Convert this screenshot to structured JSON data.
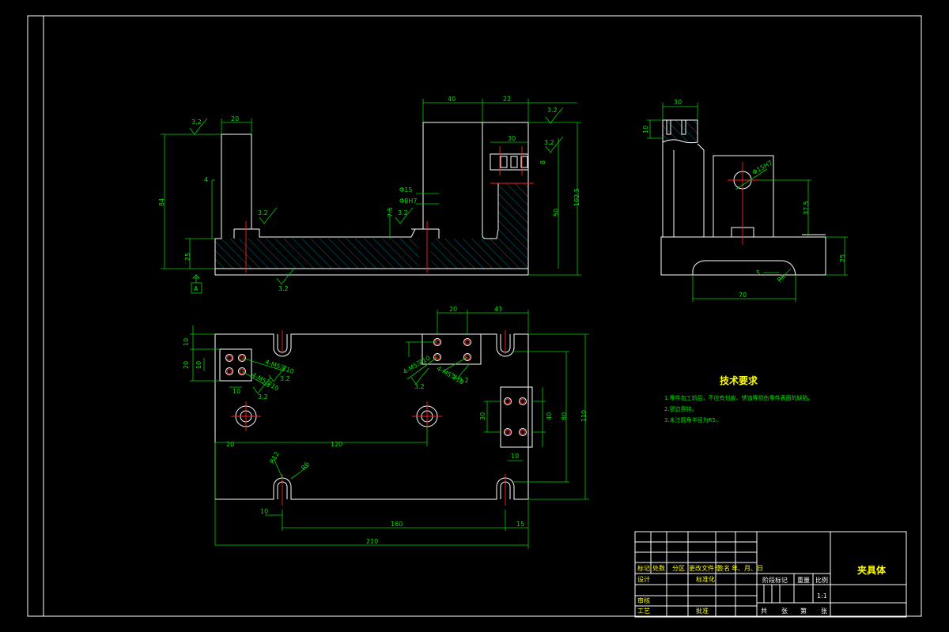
{
  "front_view": {
    "dims": {
      "d20": "20",
      "d84": "84",
      "d25": "25",
      "d40": "40",
      "d22": "22",
      "d50": "50",
      "d102_5": "102.5",
      "d30": "30",
      "d7_5": "7.5",
      "d8": "8",
      "d4": "4",
      "phi15": "Φ15",
      "phi8h7": "Φ8H7"
    },
    "roughness": {
      "r1": "3.2",
      "r2": "3.2",
      "r3": "3.2",
      "r4": "3.2",
      "r5": "3.2",
      "r6": "3.2"
    },
    "datum": "A"
  },
  "side_view": {
    "dims": {
      "d30": "30",
      "d10": "10",
      "d70": "70",
      "d25": "25",
      "d37_5": "37.5",
      "d5": "5",
      "r8": "R8",
      "phi15h7": "Φ15H7"
    }
  },
  "top_view": {
    "dims": {
      "d10a": "10",
      "d20a": "20",
      "d10b": "10",
      "d20b": "20",
      "d10c": "10",
      "d43": "43",
      "d30": "30",
      "d40": "40",
      "d80": "80",
      "d110": "110",
      "d20c": "20",
      "d120": "120",
      "d10d": "10",
      "d160": "160",
      "d15": "15",
      "d210": "210",
      "r12": "R12",
      "r6": "R6",
      "d10e": "10"
    },
    "notes": {
      "n1": "4-M5深10",
      "n2": "4-M5深10",
      "n3": "4-M5深10",
      "n4": "4-M5深10",
      "r1": "3.2",
      "r2": "3.2",
      "r3": "3.2",
      "r4": "3.2"
    }
  },
  "requirements": {
    "title": "技术要求",
    "items": [
      "1.零件加工前后，不应有划痕、锈蚀等损伤零件表面的缺陷。",
      "2.锐边倒钝。",
      "3.未注圆角半径为R5。"
    ]
  },
  "title_block": {
    "part_name": "夹具体",
    "row_labels": [
      "标记",
      "处数",
      "分区",
      "更改文件号",
      "签名",
      "年、月、日"
    ],
    "designer": "设计",
    "standard": "标准化",
    "checker": "审核",
    "process": "工艺",
    "approve": "批准",
    "stage_mark": "阶段标记",
    "weight": "重量",
    "ratio": "比例",
    "scale": "1:1",
    "sheets_total": "共",
    "sheet_word": "张",
    "sheet_no": "第",
    "sheet_word2": "张"
  }
}
